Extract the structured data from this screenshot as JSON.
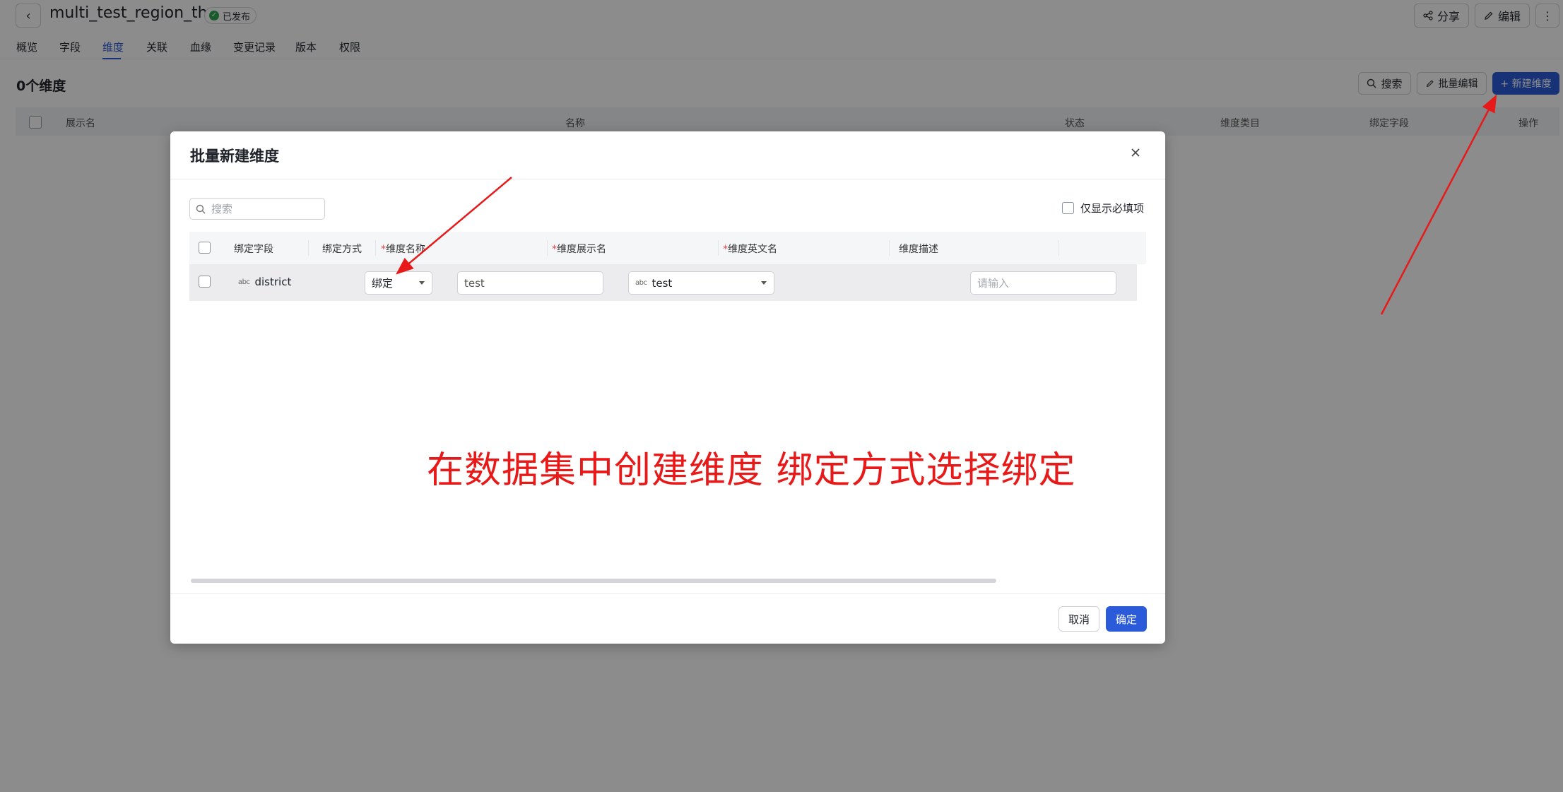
{
  "header": {
    "back_label": "‹",
    "title": "multi_test_region_th",
    "status_badge": "已发布",
    "share_label": "分享",
    "edit_label": "编辑",
    "more_label": "⋮"
  },
  "tabs": [
    {
      "label": "概览"
    },
    {
      "label": "字段"
    },
    {
      "label": "维度",
      "active": true
    },
    {
      "label": "关联"
    },
    {
      "label": "血缘"
    },
    {
      "label": "变更记录"
    },
    {
      "label": "版本"
    },
    {
      "label": "权限"
    }
  ],
  "toolbar": {
    "count_title": "0个维度",
    "search_label": "搜索",
    "batch_edit_label": "批量编辑",
    "new_dimension_label": "+ 新建维度"
  },
  "bg_table": {
    "columns": [
      "展示名",
      "名称",
      "状态",
      "维度类目",
      "绑定字段",
      "操作"
    ]
  },
  "modal": {
    "title": "批量新建维度",
    "search_placeholder": "搜索",
    "required_only_label": "仅显示必填项",
    "columns": {
      "bound_field": "绑定字段",
      "bind_method": "绑定方式",
      "dim_name": "维度名称",
      "dim_display_name": "维度展示名",
      "dim_english_name": "维度英文名",
      "dim_description": "维度描述",
      "required_mark": "*"
    },
    "row": {
      "field_type": "abc",
      "field_name": "district",
      "bind_method": "绑定",
      "dim_name": "test",
      "dim_display_type": "abc",
      "dim_display_name": "test",
      "description_placeholder": "请输入"
    },
    "cancel_label": "取消",
    "ok_label": "确定"
  },
  "annotation": {
    "text": "在数据集中创建维度 绑定方式选择绑定",
    "color": "#e81919"
  },
  "colors": {
    "primary": "#2b5bd8",
    "published_green": "#2fa84f",
    "overlay": "rgba(0,0,0,0.45)"
  }
}
